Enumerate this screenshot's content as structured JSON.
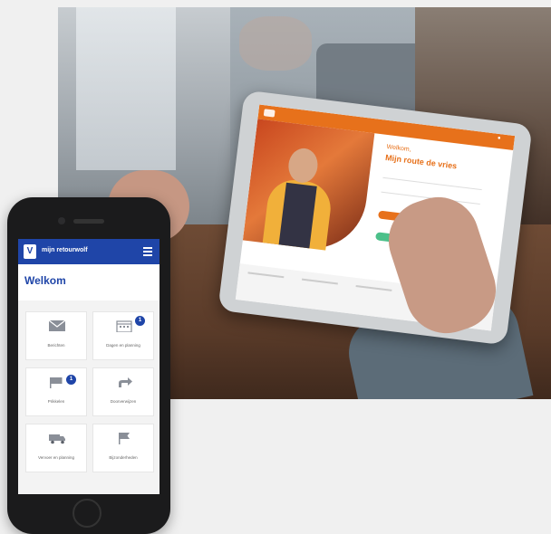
{
  "tablet": {
    "brand": "",
    "greeting": "Welkom,",
    "title": "Mijn route de vries",
    "field_1": "",
    "field_2": "",
    "login_button": "",
    "forgot_link": "",
    "note": "",
    "green_button": ""
  },
  "phone": {
    "brand": "mijn retourwolf",
    "logo_letter": "V",
    "welcome": "Welkom",
    "tiles": [
      {
        "label": "Berichten",
        "icon": "mail-icon",
        "badge": ""
      },
      {
        "label": "Dagen en planning",
        "icon": "calendar-icon",
        "badge": "1"
      },
      {
        "label": "Prikkelen",
        "icon": "flag-icon",
        "badge": "1"
      },
      {
        "label": "Doorverwijzen",
        "icon": "forward-icon",
        "badge": ""
      },
      {
        "label": "Vervoer en planning",
        "icon": "truck-icon",
        "badge": ""
      },
      {
        "label": "Bijzonderheden",
        "icon": "flag-icon",
        "badge": ""
      }
    ]
  },
  "colors": {
    "brand_blue": "#1f45a8",
    "brand_orange": "#e7711b",
    "success_green": "#4cc08a"
  }
}
